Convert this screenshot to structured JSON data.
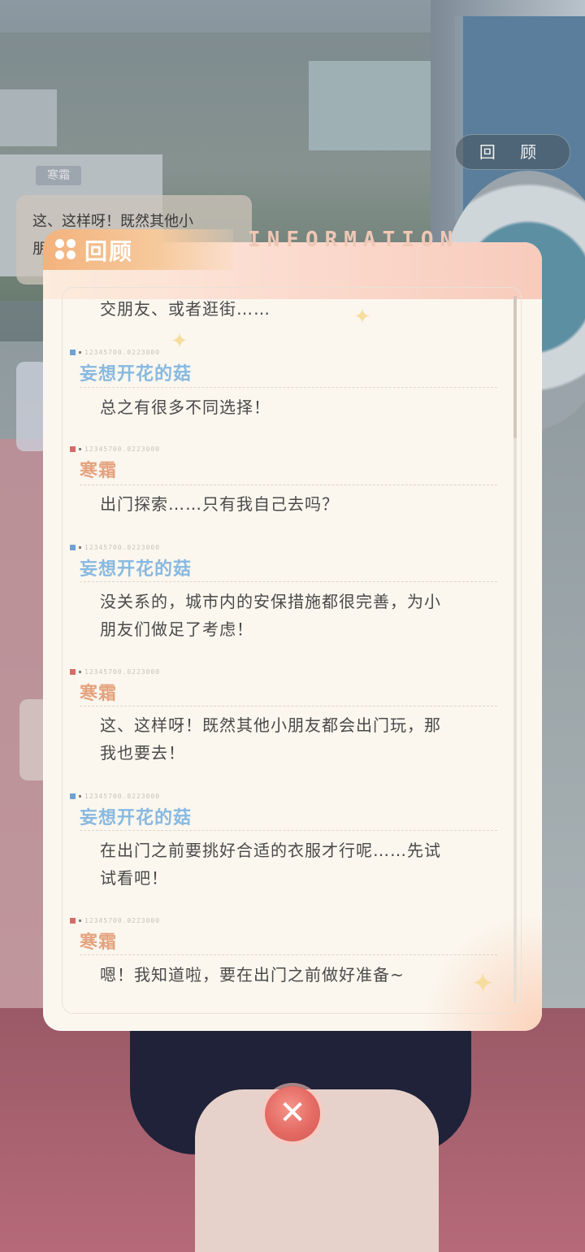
{
  "background": {
    "review_button_label": "回 顾",
    "bubble_name": "寒霜",
    "bubble_text_line1": "这、这样呀！既然其他小",
    "bubble_text_line2": "朋"
  },
  "panel": {
    "title": "回顾",
    "deco_word": "INFORMATION"
  },
  "meta_code": "12345700.0223000",
  "entries": [
    {
      "speaker": "",
      "lines": [
        "交朋友、或者逛街……"
      ]
    },
    {
      "speaker": "妄想开花的菇",
      "lines": [
        "总之有很多不同选择！"
      ]
    },
    {
      "speaker": "寒霜",
      "lines": [
        "出门探索……只有我自己去吗？"
      ]
    },
    {
      "speaker": "妄想开花的菇",
      "lines": [
        "没关系的，城市内的安保措施都很完善，为小",
        "朋友们做足了考虑！"
      ]
    },
    {
      "speaker": "寒霜",
      "lines": [
        "这、这样呀！既然其他小朋友都会出门玩，那",
        "我也要去！"
      ]
    },
    {
      "speaker": "妄想开花的菇",
      "lines": [
        "在出门之前要挑好合适的衣服才行呢……先试",
        "试看吧！"
      ]
    },
    {
      "speaker": "寒霜",
      "lines": [
        "嗯！我知道啦，要在出门之前做好准备~"
      ]
    }
  ],
  "colors": {
    "speaker_blue": "#88b9e0",
    "speaker_orange": "#e4a27e",
    "close_button": "#e46a63"
  },
  "icons": {
    "tab_icon": "four-dots-icon",
    "close_icon": "butterfly-close-icon"
  }
}
